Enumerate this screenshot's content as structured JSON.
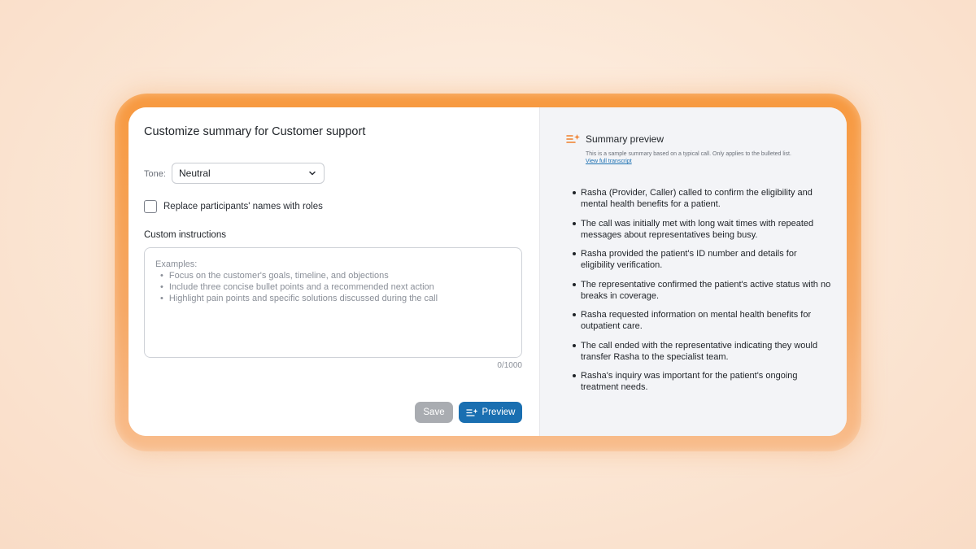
{
  "editor": {
    "title": "Customize summary for Customer support",
    "tone_label": "Tone:",
    "tone_value": "Neutral",
    "replace_names_label": "Replace participants' names with roles",
    "replace_names_checked": false,
    "custom_instructions_heading": "Custom instructions",
    "placeholder_intro": "Examples:",
    "placeholder_examples": [
      "Focus on the customer's goals, timeline, and objections",
      "Include three concise bullet points and a recommended next action",
      "Highlight pain points and specific solutions discussed during the call"
    ],
    "char_count": "0/1000",
    "save_label": "Save",
    "preview_label": "Preview"
  },
  "preview": {
    "title": "Summary preview",
    "subtitle": "This is a sample summary based on a typical call. Only applies to the bulleted list.",
    "link_label": "View full transcript",
    "bullets": [
      "Rasha (Provider, Caller) called to confirm the eligibility and mental health benefits for a patient.",
      "The call was initially met with long wait times with repeated messages about representatives being busy.",
      "Rasha provided the patient's ID number and details for eligibility verification.",
      "The representative confirmed the patient's active status with no breaks in coverage.",
      "Rasha requested information on mental health benefits for outpatient care.",
      "The call ended with the representative indicating they would transfer Rasha to the specialist team.",
      "Rasha's inquiry was important for the patient's ongoing treatment needs."
    ]
  },
  "colors": {
    "accent_blue": "#1a6fb1",
    "frame_orange": "#f7993f",
    "sparkle_orange": "#f07f2c"
  },
  "icons": [
    "chevron-down-icon",
    "sparkle-list-icon"
  ]
}
